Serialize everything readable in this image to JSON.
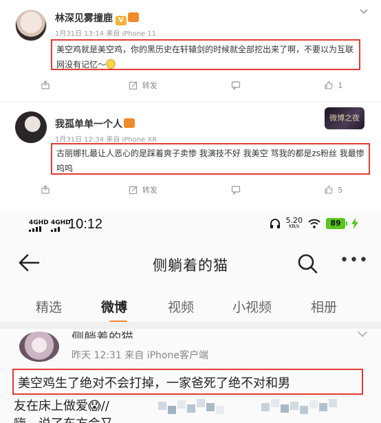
{
  "post1": {
    "username": "林深见雾撞鹿",
    "badge": "V",
    "meta": "1月31日 13:14 来自 iPhone 11",
    "text": "美空鸡就是美空鸡，你的黑历史在轩辕剑的时候就全部挖出来了啊，不要以为互联网没有记忆～",
    "actions": {
      "share": "",
      "repost": "转发",
      "comment": "",
      "like": "1"
    }
  },
  "post2": {
    "username": "我孤单单一个人",
    "meta": "1月31日 12:34 来自 iPhone XR",
    "topic_badge": "微博之夜",
    "text": "古丽娜扎最让人恶心的是踩着爽子卖惨 我演技不好 我美空 骂我的都是zs粉丝 我最惨 呜呜",
    "actions": {
      "share": "",
      "repost": "转发",
      "comment": "",
      "like": "5"
    }
  },
  "phone": {
    "status": {
      "sig1": "4GHD",
      "sig2": "4GHD",
      "time": "10:12",
      "speed": "5.20",
      "speed_unit": "KB/s",
      "battery": "89"
    },
    "nav_title": "侧躺着的猫",
    "tabs": [
      "精选",
      "微博",
      "视频",
      "小视频",
      "相册"
    ],
    "active_tab": "微博",
    "post": {
      "username": "侧躺着的猫",
      "meta": "昨天 12:31  来自 iPhone客户端",
      "line1": "美空鸡生了绝对不会打掉，一家爸死了绝不对和男",
      "line2": "友在床上做爱😱//",
      "line3": "嗨，说了东方会又"
    }
  },
  "colors": {
    "highlight_red": "#e53935",
    "accent_orange": "#f08a2b",
    "battery_green": "#57c51b"
  }
}
